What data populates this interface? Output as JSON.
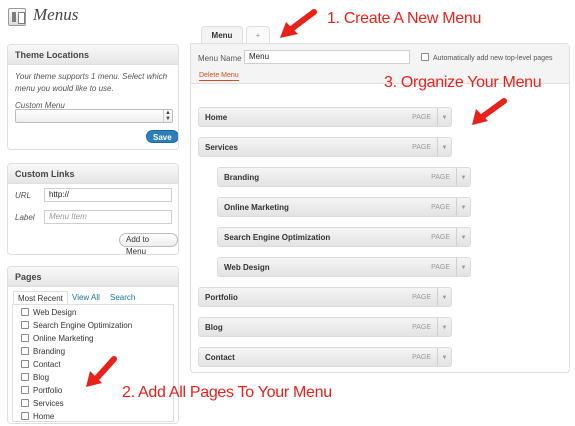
{
  "page": {
    "title": "Menus",
    "icon": "menus-icon"
  },
  "theme_locations": {
    "heading": "Theme Locations",
    "help": "Your theme supports 1 menu. Select which menu you would like to use.",
    "select_label": "Custom Menu",
    "select_value": "",
    "save_label": "Save"
  },
  "custom_links": {
    "heading": "Custom Links",
    "url_label": "URL",
    "url_value": "http://",
    "label_label": "Label",
    "label_placeholder": "Menu Item",
    "add_button": "Add to Menu"
  },
  "pages_box": {
    "heading": "Pages",
    "tabs": [
      "Most Recent",
      "View All",
      "Search"
    ],
    "items": [
      "Web Design",
      "Search Engine Optimization",
      "Online Marketing",
      "Branding",
      "Contact",
      "Blog",
      "Portfolio",
      "Services",
      "Home"
    ]
  },
  "menu_tabs": {
    "active": "Menu",
    "add": "+"
  },
  "menu_editor": {
    "name_label": "Menu Name",
    "name_value": "Menu",
    "auto_add_label": "Automatically add new top-level pages",
    "delete_label": "Delete Menu",
    "items": [
      {
        "label": "Home",
        "type": "PAGE",
        "depth": 0
      },
      {
        "label": "Services",
        "type": "PAGE",
        "depth": 0
      },
      {
        "label": "Branding",
        "type": "PAGE",
        "depth": 1
      },
      {
        "label": "Online Marketing",
        "type": "PAGE",
        "depth": 1
      },
      {
        "label": "Search Engine Optimization",
        "type": "PAGE",
        "depth": 1
      },
      {
        "label": "Web Design",
        "type": "PAGE",
        "depth": 1
      },
      {
        "label": "Portfolio",
        "type": "PAGE",
        "depth": 0
      },
      {
        "label": "Blog",
        "type": "PAGE",
        "depth": 0
      },
      {
        "label": "Contact",
        "type": "PAGE",
        "depth": 0
      }
    ]
  },
  "annotations": {
    "step1": "1. Create A New Menu",
    "step2": "2. Add All Pages To Your Menu",
    "step3": "3. Organize Your Menu"
  },
  "colors": {
    "accent": "#e8211b",
    "link": "#21759b",
    "button": "#2c7fb8"
  }
}
